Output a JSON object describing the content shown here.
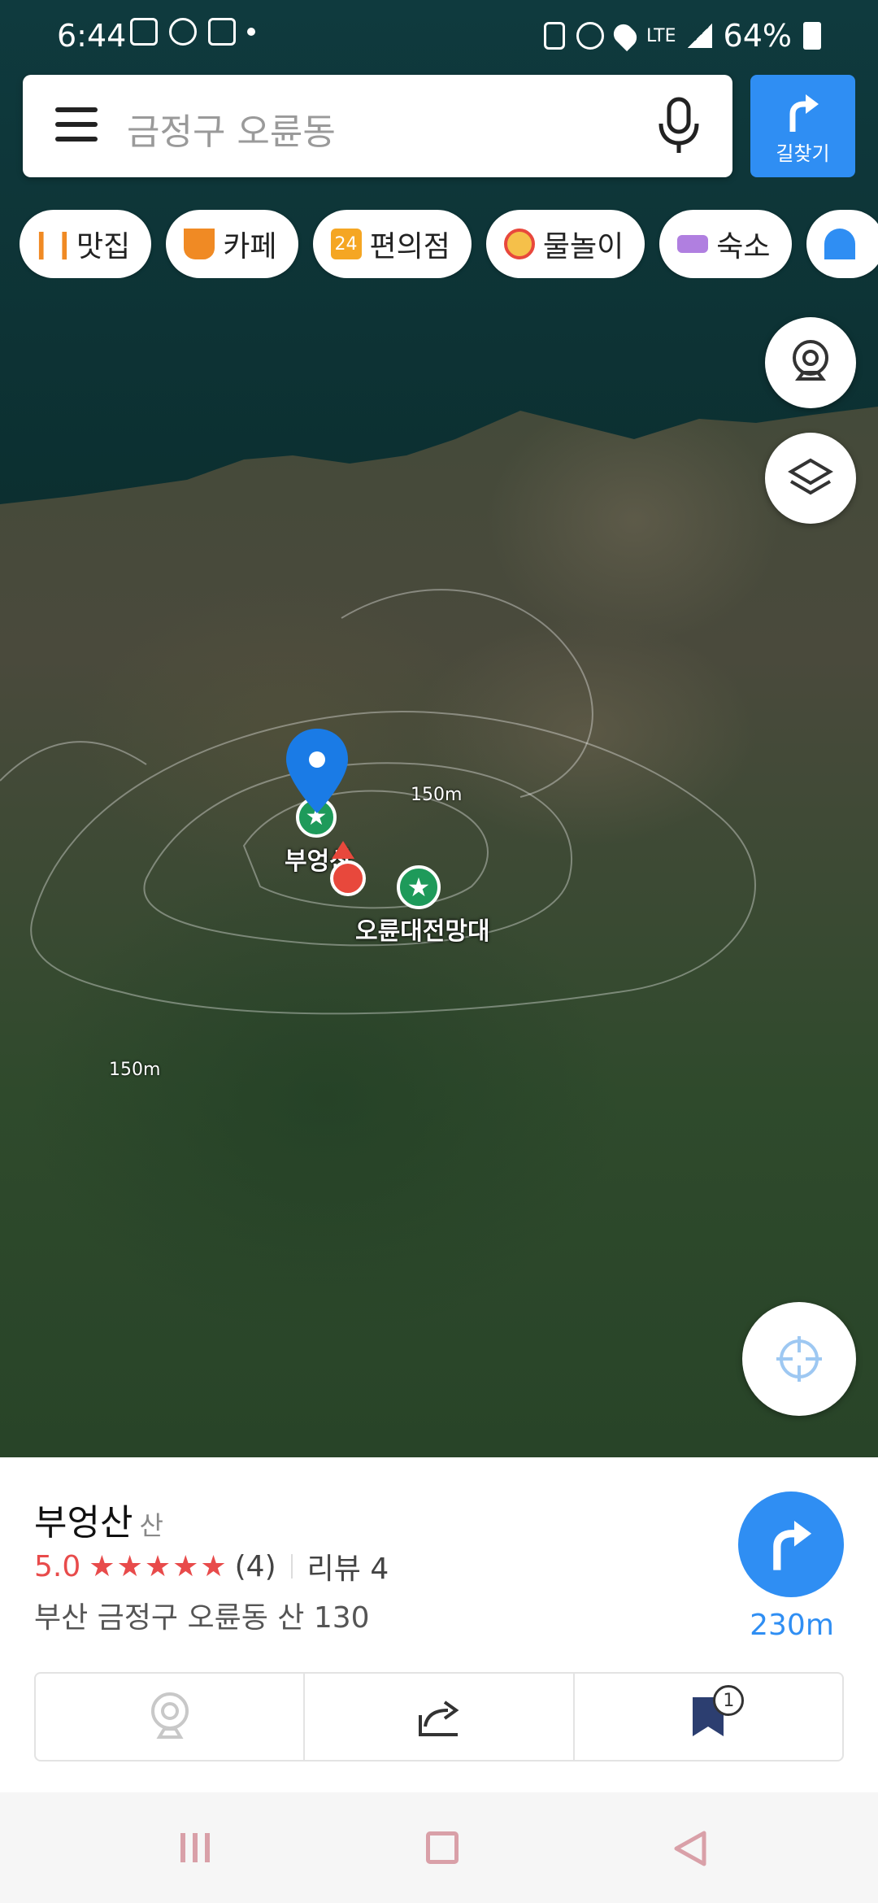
{
  "status_bar": {
    "time": "6:44",
    "network": "LTE",
    "battery": "64%"
  },
  "search": {
    "placeholder": "금정구 오륜동",
    "route_label": "길찾기"
  },
  "categories": [
    {
      "label": "맛집",
      "icon": "restaurant-icon",
      "color": "#f08a24"
    },
    {
      "label": "카페",
      "icon": "cafe-icon",
      "color": "#f08a24"
    },
    {
      "label": "편의점",
      "icon": "convenience-store-icon",
      "color": "#f5a623",
      "icon_text": "24"
    },
    {
      "label": "물놀이",
      "icon": "water-play-icon",
      "color": "#f5a623"
    },
    {
      "label": "숙소",
      "icon": "lodging-icon",
      "color": "#b07fe0"
    },
    {
      "label": "",
      "icon": "beach-umbrella-icon",
      "color": "#2f8ef3"
    }
  ],
  "map": {
    "pois": [
      {
        "name": "부엉산"
      },
      {
        "name": "오륜대전망대"
      }
    ],
    "contours": [
      "150m",
      "150m"
    ]
  },
  "place": {
    "name": "부엉산",
    "category": "산",
    "rating": "5.0",
    "stars": "★★★★★",
    "rating_count": "(4)",
    "review": "리뷰 4",
    "address": "부산 금정구 오륜동 산 130",
    "distance": "230m",
    "saved_count": "1"
  },
  "colors": {
    "accent": "#2f8ef3",
    "rating": "#e84b4b"
  }
}
